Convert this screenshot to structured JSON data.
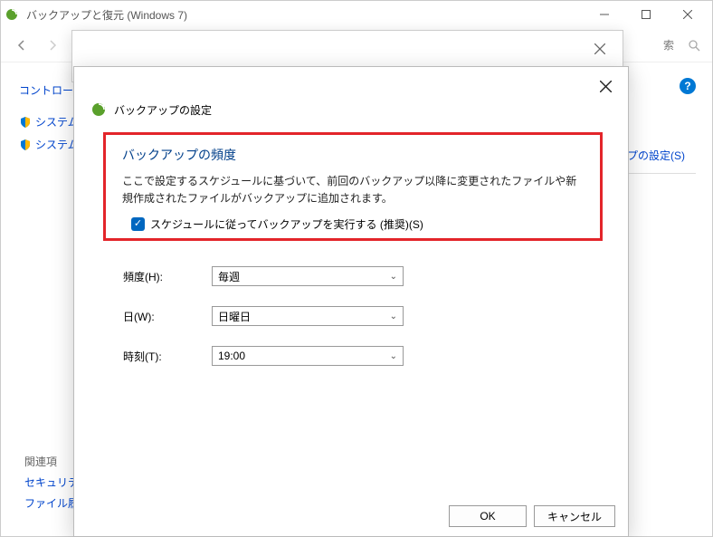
{
  "window": {
    "title": "バックアップと復元 (Windows 7)"
  },
  "nav": {
    "search_fragment": "索"
  },
  "left": {
    "control_panel": "コントロー",
    "sys1": "システム",
    "sys2": "システム"
  },
  "right": {
    "settings_link": "プの設定(S)"
  },
  "related": {
    "heading": "関連項",
    "security": "セキュリテ",
    "history": "ファイル履"
  },
  "dialog": {
    "header": "バックアップの設定",
    "section_title": "バックアップの頻度",
    "description": "ここで設定するスケジュールに基づいて、前回のバックアップ以降に変更されたファイルや新規作成されたファイルがバックアップに追加されます。",
    "checkbox_label": "スケジュールに従ってバックアップを実行する (推奨)(S)",
    "fields": {
      "frequency_label": "頻度(H):",
      "frequency_value": "毎週",
      "day_label": "日(W):",
      "day_value": "日曜日",
      "time_label": "時刻(T):",
      "time_value": "19:00"
    },
    "ok": "OK",
    "cancel": "キャンセル"
  }
}
